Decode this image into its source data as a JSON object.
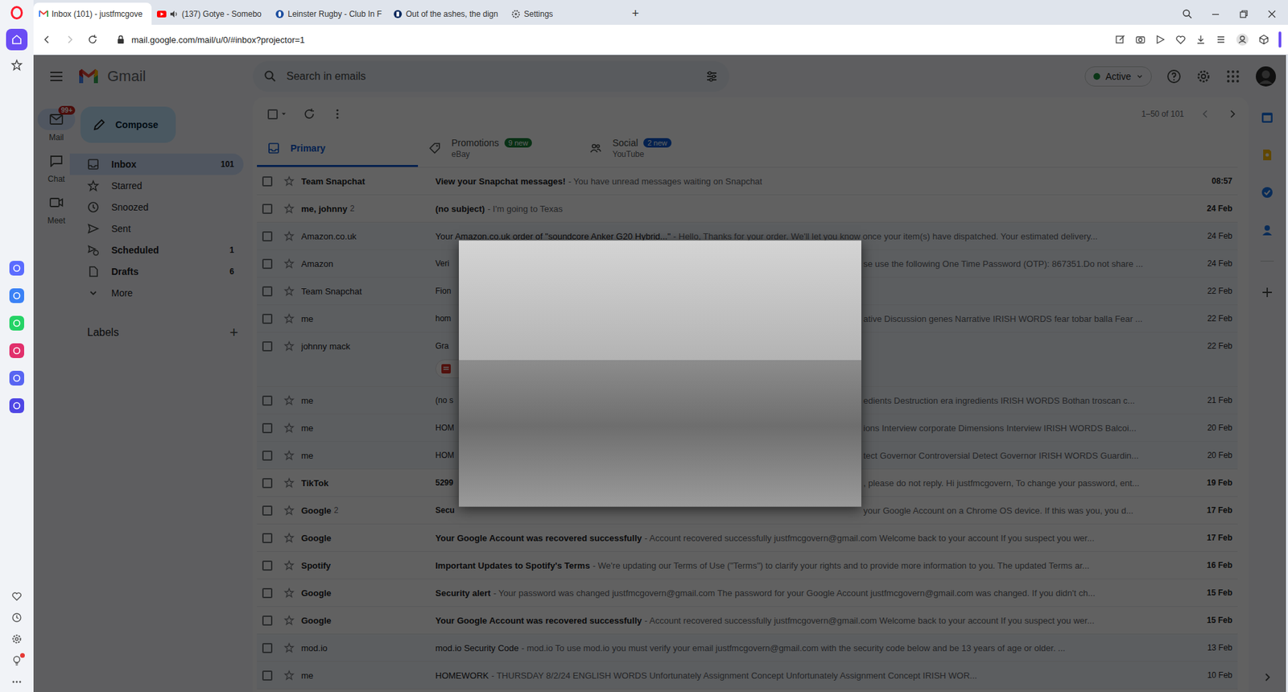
{
  "browser": {
    "tabs": [
      {
        "label": "Inbox (101) - justfmcgove",
        "kind": "gmail",
        "selected": true,
        "audio": false
      },
      {
        "label": "(137) Gotye - Somebo",
        "kind": "youtube",
        "selected": false,
        "audio": true
      },
      {
        "label": "Leinster Rugby - Club In F",
        "kind": "rugby",
        "selected": false,
        "audio": false
      },
      {
        "label": "Out of the ashes, the dign",
        "kind": "article",
        "selected": false,
        "audio": false
      },
      {
        "label": "Settings",
        "kind": "settings",
        "selected": false,
        "audio": false
      }
    ],
    "new_tab": "+",
    "address": "mail.google.com/mail/u/0/#inbox?projector=1"
  },
  "opera_sidebar": {
    "top": [
      {
        "kind": "home",
        "selected": true
      },
      {
        "kind": "star",
        "selected": false
      }
    ],
    "apps": [
      {
        "kind": "aria",
        "color": "#5b6cff"
      },
      {
        "kind": "messenger",
        "color": "#3b82f6"
      },
      {
        "kind": "whatsapp",
        "color": "#25d366"
      },
      {
        "kind": "instagram",
        "color": "#e1306c"
      },
      {
        "kind": "discord",
        "color": "#5865f2"
      },
      {
        "kind": "player",
        "color": "#4f46e5"
      }
    ],
    "bottom": [
      {
        "kind": "heart",
        "notification": false
      },
      {
        "kind": "history",
        "notification": false
      },
      {
        "kind": "settings",
        "notification": false
      },
      {
        "kind": "bulb",
        "notification": true
      },
      {
        "kind": "more",
        "notification": false
      }
    ]
  },
  "gmail": {
    "app_name": "Gmail",
    "search_placeholder": "Search in emails",
    "status": "Active",
    "rail": [
      {
        "label": "Mail",
        "badge": "99+",
        "selected": true
      },
      {
        "label": "Chat",
        "selected": false
      },
      {
        "label": "Meet",
        "selected": false
      }
    ],
    "compose": "Compose",
    "nav": [
      {
        "label": "Inbox",
        "count": "101",
        "selected": true,
        "bold": true
      },
      {
        "label": "Starred",
        "selected": false,
        "bold": false
      },
      {
        "label": "Snoozed",
        "selected": false,
        "bold": false
      },
      {
        "label": "Sent",
        "selected": false,
        "bold": false
      },
      {
        "label": "Scheduled",
        "count": "1",
        "selected": false,
        "bold": true
      },
      {
        "label": "Drafts",
        "count": "6",
        "selected": false,
        "bold": true
      },
      {
        "label": "More",
        "selected": false,
        "bold": false
      }
    ],
    "labels_title": "Labels",
    "labels_add": "+",
    "pagination": "1–50 of 101",
    "categories": [
      {
        "label": "Primary",
        "selected": true
      },
      {
        "label": "Promotions",
        "badge": "9 new",
        "sub": "eBay",
        "color": "#188038",
        "selected": false
      },
      {
        "label": "Social",
        "badge": "2 new",
        "sub": "YouTube",
        "color": "#0b57d0",
        "selected": false
      }
    ],
    "emails": [
      {
        "kind": "full",
        "sender": "Team Snapchat",
        "unread": true,
        "attachment": false,
        "subject": "View your Snapchat messages!",
        "snippet": "- You have unread messages waiting on Snapchat",
        "date": "08:57"
      },
      {
        "kind": "full",
        "sender": "me, johnny",
        "count": "2",
        "unread": true,
        "attachment": false,
        "subject": "(no subject)",
        "snippet": "- I'm going to Texas",
        "date": "24 Feb"
      },
      {
        "kind": "full",
        "sender": "Amazon.co.uk",
        "unread": false,
        "attachment": false,
        "subject": "Your Amazon.co.uk order of \"soundcore Anker G20 Hybrid...\"",
        "snippet": "- Hello, Thanks for your order. We'll let you know once your item(s) have dispatched. Your estimated delivery...",
        "date": "24 Feb"
      },
      {
        "kind": "split",
        "sender": "Amazon",
        "unread": false,
        "attachment": false,
        "lead": "Veri",
        "tail": "se use the following One Time Password (OTP): 867351.Do not share ...",
        "date": "24 Feb"
      },
      {
        "kind": "split",
        "sender": "Team Snapchat",
        "unread": false,
        "attachment": false,
        "lead": "Fion",
        "date": "22 Feb"
      },
      {
        "kind": "split",
        "sender": "me",
        "unread": false,
        "attachment": false,
        "lead": "hom",
        "tail": "ative Discussion genes Narrative IRISH WORDS fear tobar balla Fear ...",
        "date": "22 Feb"
      },
      {
        "kind": "split",
        "sender": "johnny mack",
        "unread": false,
        "attachment": true,
        "lead": "Gra",
        "date": "22 Feb"
      },
      {
        "kind": "split",
        "sender": "me",
        "unread": false,
        "attachment": false,
        "lead": "(no s",
        "tail": "edients Destruction era ingredients IRISH WORDS Bothan troscan c...",
        "date": "21 Feb"
      },
      {
        "kind": "split",
        "sender": "me",
        "unread": false,
        "attachment": false,
        "lead": "HOM",
        "tail": "ions Interview corporate Dimensions Interview IRISH WORDS Balcoi...",
        "date": "20 Feb"
      },
      {
        "kind": "split",
        "sender": "me",
        "unread": false,
        "attachment": false,
        "lead": "HOM",
        "tail": "tect Governor Controversial Detect Governor IRISH WORDS Guardin...",
        "date": "20 Feb"
      },
      {
        "kind": "split",
        "sender": "TikTok",
        "unread": true,
        "attachment": false,
        "lead": "5299",
        "tail": ", please do not reply. Hi justfmcgovern, To change your password, ent...",
        "date": "19 Feb"
      },
      {
        "kind": "split",
        "sender": "Google",
        "count": "2",
        "unread": true,
        "attachment": false,
        "lead": "Secu",
        "tail": "your Google Account on a Chrome OS device. If this was you, you d...",
        "date": "17 Feb"
      },
      {
        "kind": "full",
        "sender": "Google",
        "unread": true,
        "attachment": false,
        "subject": "Your Google Account was recovered successfully",
        "snippet": "- Account recovered successfully justfmcgovern@gmail.com Welcome back to your account If you suspect you wer...",
        "date": "17 Feb"
      },
      {
        "kind": "full",
        "sender": "Spotify",
        "unread": true,
        "attachment": false,
        "subject": "Important Updates to Spotify's Terms",
        "snippet": "- We're updating our Terms of Use (\"Terms\") to clarify your rights and to provide more information to you. The updated Terms ar...",
        "date": "16 Feb"
      },
      {
        "kind": "full",
        "sender": "Google",
        "unread": true,
        "attachment": false,
        "subject": "Security alert",
        "snippet": "- Your password was changed justfmcgovern@gmail.com The password for your Google Account justfmcgovern@gmail.com was changed. If you didn't ch...",
        "date": "15 Feb"
      },
      {
        "kind": "full",
        "sender": "Google",
        "unread": true,
        "attachment": false,
        "subject": "Your Google Account was recovered successfully",
        "snippet": "- Account recovered successfully justfmcgovern@gmail.com Welcome back to your account If you suspect you wer...",
        "date": "15 Feb"
      },
      {
        "kind": "full",
        "sender": "mod.io",
        "unread": false,
        "attachment": false,
        "subject": "mod.io Security Code",
        "snippet": "- mod.io To use mod.io you must verify your email justfmcgovern@gmail.com with the security code below and be 13 years of age or older. ...",
        "date": "13 Feb"
      },
      {
        "kind": "full",
        "sender": "me",
        "unread": false,
        "attachment": false,
        "subject": "HOMEWORK",
        "snippet": "- THURSDAY 8/2/24 ENGLISH WORDS Unfortunately Assignment Concept Unfortunately Assignment Concept IRISH WOR...",
        "date": "10 Feb"
      }
    ]
  },
  "lightbox": {
    "open": true
  }
}
